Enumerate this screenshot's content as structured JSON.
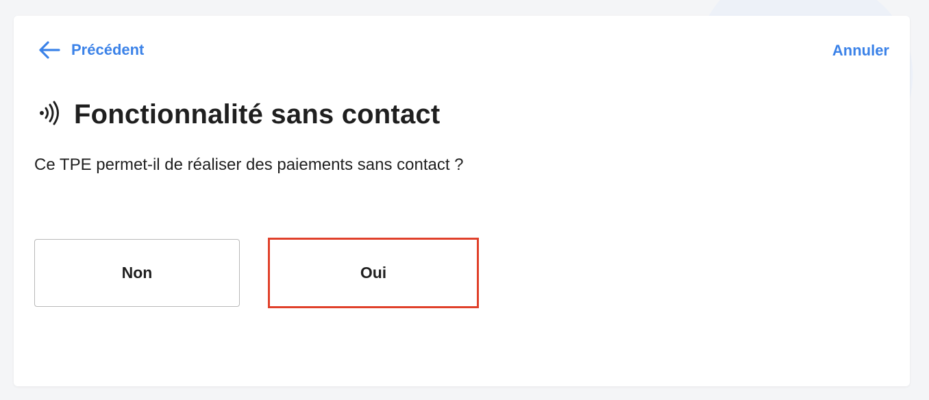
{
  "header": {
    "back_label": "Précédent",
    "cancel_label": "Annuler"
  },
  "main": {
    "title": "Fonctionnalité sans contact",
    "title_icon": "contactless-icon",
    "question": "Ce TPE permet-il de réaliser des paiements sans contact ?",
    "choices": [
      {
        "label": "Non",
        "selected": false
      },
      {
        "label": "Oui",
        "selected": true
      }
    ]
  },
  "colors": {
    "accent": "#3b82e8",
    "text": "#1f1f1f",
    "highlight": "#e0402a"
  }
}
